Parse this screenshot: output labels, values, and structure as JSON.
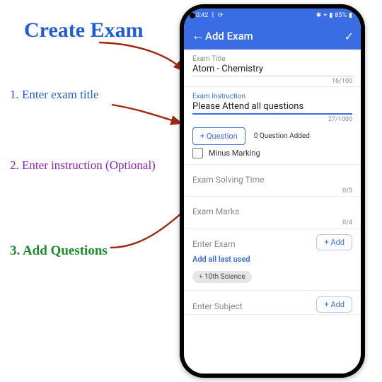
{
  "annotation": {
    "title": "Create Exam",
    "step1": "1. Enter exam title",
    "step2": "2. Enter instruction (Optional)",
    "step3": "3. Add Questions"
  },
  "statusbar": {
    "time": "10:42",
    "battery": "85%"
  },
  "appbar": {
    "title": "Add Exam"
  },
  "exam": {
    "title_label": "Exam Title",
    "title_value": "Atom - Chemistry",
    "title_counter": "16/100",
    "instruction_label": "Exam Instruction",
    "instruction_value": "Please Attend all questions",
    "instruction_counter": "27/1000",
    "add_question_btn": "+ Question",
    "question_added": "0 Question Added",
    "minus_marking": "Minus Marking",
    "solving_time": {
      "placeholder": "Exam Solving Time",
      "counter": "0/3"
    },
    "marks": {
      "placeholder": "Exam Marks",
      "counter": "0/4"
    },
    "enter_exam": {
      "placeholder": "Enter Exam",
      "add": "+ Add"
    },
    "add_all_last_used": "Add all last used",
    "chip1": "10th Science",
    "enter_subject": {
      "placeholder": "Enter Subject",
      "add": "+ Add"
    }
  }
}
